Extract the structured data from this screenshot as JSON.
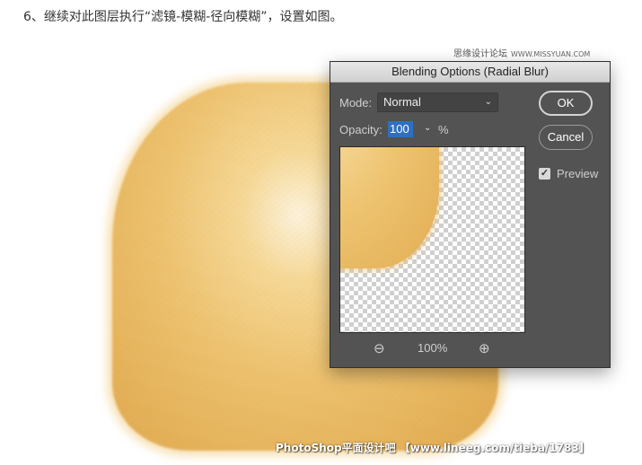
{
  "article": {
    "instruction": "6、继续对此图层执行“滤镜-模糊-径向模糊”，设置如图。",
    "site_name": "思缘设计论坛",
    "site_url": "WWW.MISSYUAN.COM",
    "watermark": "PhotoShop平面设计吧 【www.lineeg.com/tieba/1783】"
  },
  "dialog": {
    "title": "Blending Options (Radial Blur)",
    "mode_label": "Mode:",
    "mode_value": "Normal",
    "opacity_label": "Opacity:",
    "opacity_value": "100",
    "opacity_unit": "%",
    "ok_label": "OK",
    "cancel_label": "Cancel",
    "preview_label": "Preview",
    "preview_checked": true,
    "zoom_level": "100%"
  },
  "icons": {
    "select_chevron": "chevron-down-icon",
    "checkmark": "checkmark-icon",
    "zoom_out": "zoom-out-icon",
    "zoom_in": "zoom-in-icon"
  },
  "colors": {
    "dialog_bg": "#535353",
    "selection_blue": "#2f6fc0",
    "fur_gold": "#e9b95f"
  }
}
